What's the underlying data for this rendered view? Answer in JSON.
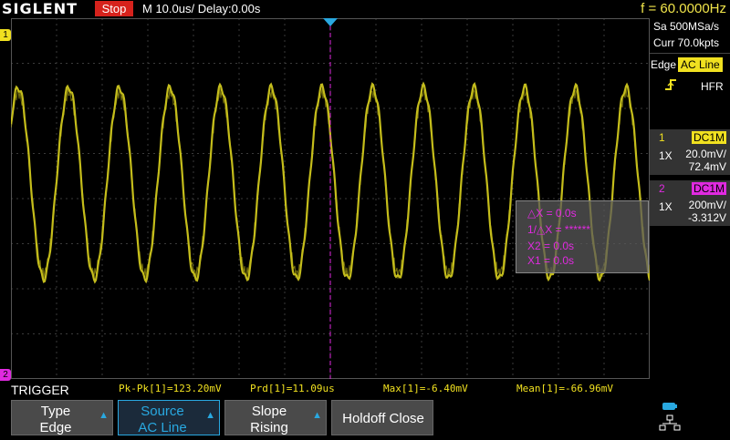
{
  "brand": "SIGLENT",
  "run_state": "Stop",
  "timebase": "M 10.0us/",
  "delay": "Delay:0.00s",
  "trigger_frequency": "f = 60.0000Hz",
  "sample_rate": "Sa 500MSa/s",
  "memory_depth": "Curr 70.0kpts",
  "trigger": {
    "type_label": "Edge",
    "source": "AC Line",
    "coupling": "HFR"
  },
  "channels": [
    {
      "num": "1",
      "coupling": "DC1M",
      "probe": "1X",
      "scale": "20.0mV/",
      "offset": "72.4mV",
      "color": "#f0e020"
    },
    {
      "num": "2",
      "coupling": "DC1M",
      "probe": "1X",
      "scale": "200mV/",
      "offset": "-3.312V",
      "color": "#e02ae0"
    }
  ],
  "cursors": {
    "dx": "△X = 0.0s",
    "inv_dx": "1/△X = ******",
    "x2": "X2 = 0.0s",
    "x1": "X1 = 0.0s"
  },
  "measurements": {
    "pkpk": "Pk-Pk[1]=123.20mV",
    "prd": "Prd[1]=11.09us",
    "max": "Max[1]=-6.40mV",
    "mean": "Mean[1]=-66.96mV"
  },
  "menu_title": "TRIGGER",
  "softkeys": [
    {
      "line1": "Type",
      "line2": "Edge",
      "active": false
    },
    {
      "line1": "Source",
      "line2": "AC Line",
      "active": true
    },
    {
      "line1": "Slope",
      "line2": "Rising",
      "active": false
    },
    {
      "label": "Holdoff Close",
      "active": false
    }
  ],
  "markers": {
    "ch1": "1",
    "ch2": "2"
  },
  "colors": {
    "ch1": "#f0e020",
    "ch2": "#e02ae0",
    "trigger": "#29a8e0",
    "stop": "#d6221c"
  },
  "icons": [
    "usb-icon",
    "network-icon"
  ]
}
